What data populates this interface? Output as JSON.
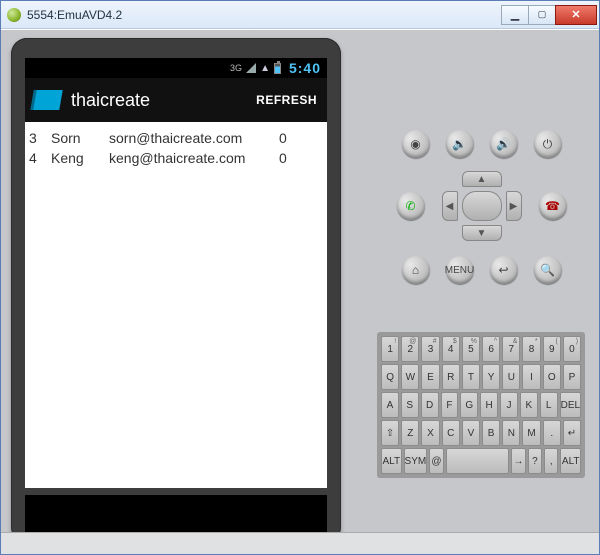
{
  "window": {
    "title": "5554:EmuAVD4.2"
  },
  "status": {
    "netlabel": "3G",
    "time": "5:40"
  },
  "app": {
    "icon_name": "folder-icon",
    "title": "thaicreate",
    "refresh": "REFRESH"
  },
  "rows": [
    {
      "id": "3",
      "name": "Sorn",
      "email": "sorn@thaicreate.com",
      "num": "0"
    },
    {
      "id": "4",
      "name": "Keng",
      "email": "keng@thaicreate.com",
      "num": "0"
    }
  ],
  "controls": {
    "row1": [
      "camera-icon",
      "volume-down-icon",
      "volume-up-icon",
      "power-icon"
    ],
    "row1_glyph": [
      "◉",
      "🔉",
      "🔊",
      "⏻"
    ],
    "call": "call-icon",
    "end": "end-call-icon",
    "row3": [
      "home-icon",
      "menu-icon",
      "back-icon",
      "search-icon"
    ],
    "row3_glyph": [
      "⌂",
      "MENU",
      "↩",
      "🔍"
    ]
  },
  "keyboard": {
    "r1_sup": [
      "!",
      "@",
      "#",
      "$",
      "%",
      "^",
      "&",
      "*",
      "(",
      ")"
    ],
    "r1": [
      "1",
      "2",
      "3",
      "4",
      "5",
      "6",
      "7",
      "8",
      "9",
      "0"
    ],
    "r2": [
      "Q",
      "W",
      "E",
      "R",
      "T",
      "Y",
      "U",
      "I",
      "O",
      "P"
    ],
    "r3": [
      "A",
      "S",
      "D",
      "F",
      "G",
      "H",
      "J",
      "K",
      "L",
      "DEL"
    ],
    "r4": [
      "⇧",
      "Z",
      "X",
      "C",
      "V",
      "B",
      "N",
      "M",
      ".",
      "↵"
    ],
    "r5": [
      "ALT",
      "SYM",
      "@",
      "",
      "→",
      "?",
      ",",
      "ALT"
    ]
  }
}
